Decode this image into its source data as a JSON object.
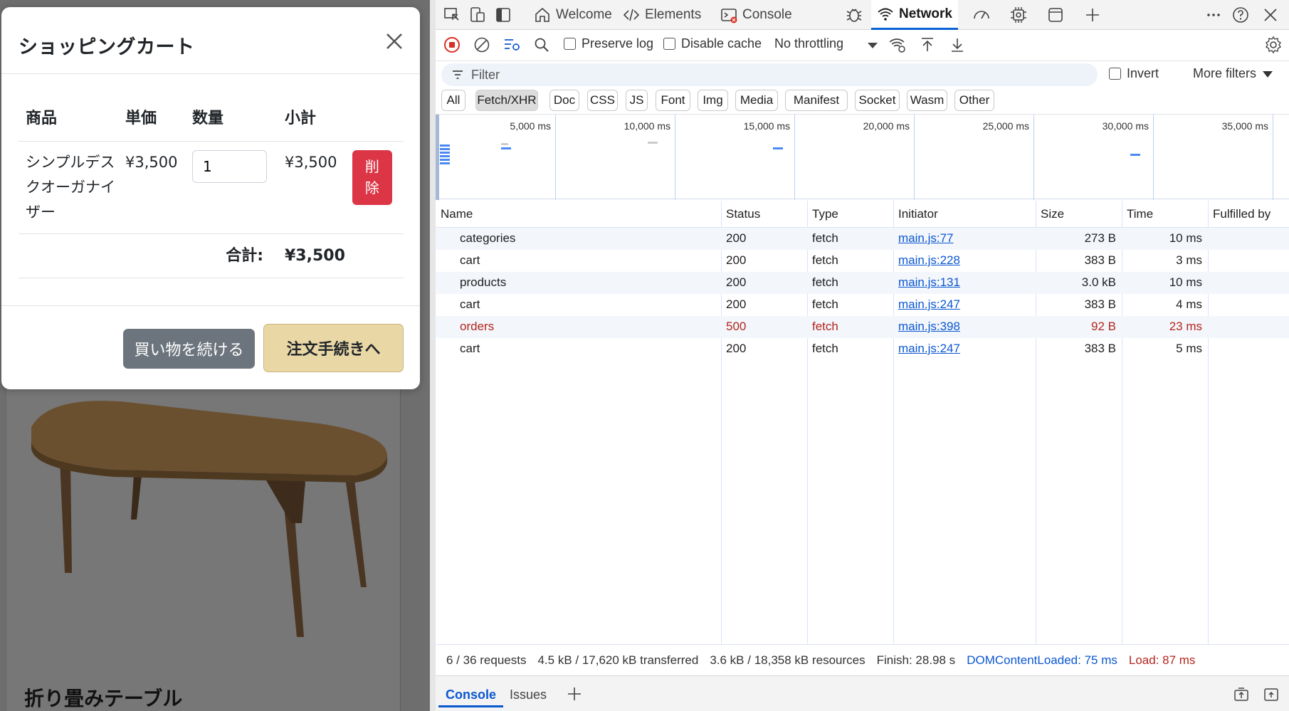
{
  "modal": {
    "title": "ショッピングカート",
    "headers": [
      "商品",
      "単価",
      "数量",
      "小計"
    ],
    "item": {
      "name_lines": [
        "シンプルデス",
        "クオーガナイ",
        "ザー"
      ],
      "price": "¥3,500",
      "qty": "1",
      "subtotal": "¥3,500",
      "delete_lines": [
        "削",
        "除"
      ]
    },
    "total_label": "合計:",
    "total_value": "¥3,500",
    "continue_label": "買い物を続ける",
    "checkout_label": "注文手続きへ"
  },
  "background_product": {
    "title": "折り畳みテーブル"
  },
  "devtools": {
    "tabs": [
      "Welcome",
      "Elements",
      "Console",
      "Network"
    ],
    "active_tab": "Network",
    "toolbar": {
      "preserve_log": "Preserve log",
      "disable_cache": "Disable cache",
      "throttling": "No throttling"
    },
    "filter_placeholder": "Filter",
    "invert_label": "Invert",
    "more_filters": "More filters",
    "type_filters": [
      "All",
      "Fetch/XHR",
      "Doc",
      "CSS",
      "JS",
      "Font",
      "Img",
      "Media",
      "Manifest",
      "Socket",
      "Wasm",
      "Other"
    ],
    "active_type": "Fetch/XHR",
    "timeline_labels": [
      "5,000 ms",
      "10,000 ms",
      "15,000 ms",
      "20,000 ms",
      "25,000 ms",
      "30,000 ms",
      "35,000 ms"
    ],
    "columns": [
      "Name",
      "Status",
      "Type",
      "Initiator",
      "Size",
      "Time",
      "Fulfilled by"
    ],
    "rows": [
      {
        "name": "categories",
        "status": "200",
        "type": "fetch",
        "initiator": "main.js:77",
        "size": "273 B",
        "time": "10 ms",
        "error": false
      },
      {
        "name": "cart",
        "status": "200",
        "type": "fetch",
        "initiator": "main.js:228",
        "size": "383 B",
        "time": "3 ms",
        "error": false
      },
      {
        "name": "products",
        "status": "200",
        "type": "fetch",
        "initiator": "main.js:131",
        "size": "3.0 kB",
        "time": "10 ms",
        "error": false
      },
      {
        "name": "cart",
        "status": "200",
        "type": "fetch",
        "initiator": "main.js:247",
        "size": "383 B",
        "time": "4 ms",
        "error": false
      },
      {
        "name": "orders",
        "status": "500",
        "type": "fetch",
        "initiator": "main.js:398",
        "size": "92 B",
        "time": "23 ms",
        "error": true
      },
      {
        "name": "cart",
        "status": "200",
        "type": "fetch",
        "initiator": "main.js:247",
        "size": "383 B",
        "time": "5 ms",
        "error": false
      }
    ],
    "status_bar": {
      "requests": "6 / 36 requests",
      "transferred": "4.5 kB / 17,620 kB transferred",
      "resources": "3.6 kB / 18,358 kB resources",
      "finish": "Finish: 28.98 s",
      "dom_content_loaded": "DOMContentLoaded: 75 ms",
      "load": "Load: 87 ms"
    },
    "drawer_tabs": [
      "Console",
      "Issues"
    ],
    "colors": {
      "accent": "#0b57d0",
      "error": "#b3261e",
      "delete": "#dc3545",
      "checkout": "#e9d8a6"
    }
  }
}
